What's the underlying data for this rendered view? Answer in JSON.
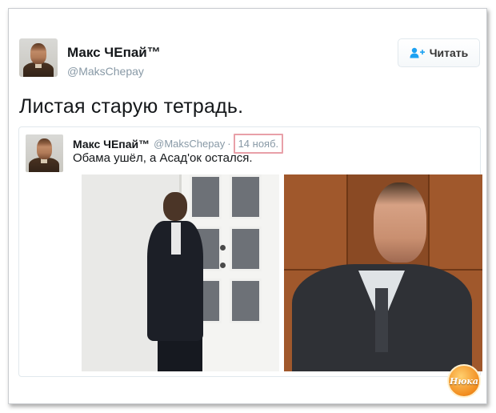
{
  "tweet": {
    "author_name": "Макс ЧЕпай™",
    "author_handle": "@MaksChepay",
    "follow_label": "Читать",
    "text": "Листая старую тетрадь."
  },
  "quoted_tweet": {
    "author_name": "Макс ЧЕпай™",
    "author_handle": "@MaksChepay",
    "separator": "·",
    "date": "14 нояб.",
    "text": "Обама ушёл, а Асад'ок остался."
  },
  "watermark": {
    "text": "Нюка"
  },
  "icons": {
    "follow": "add-user-icon"
  },
  "colors": {
    "follow_icon": "#1da1f2",
    "date_highlight": "#e8a0a8",
    "watermark": "#f28c1e"
  }
}
